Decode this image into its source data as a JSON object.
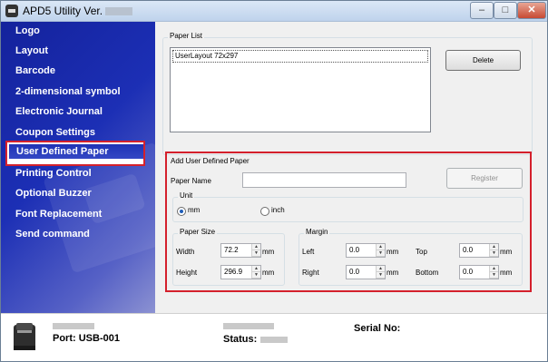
{
  "window": {
    "title": "APD5 Utility Ver.",
    "minimize": "–",
    "maximize": "□",
    "close": "✕"
  },
  "sidebar": {
    "items": [
      {
        "label": "Logo"
      },
      {
        "label": "Layout"
      },
      {
        "label": "Barcode"
      },
      {
        "label": "2-dimensional symbol"
      },
      {
        "label": "Electronic Journal"
      },
      {
        "label": "Coupon Settings"
      },
      {
        "label": "User Defined Paper"
      },
      {
        "label": "Printing Control"
      },
      {
        "label": "Optional Buzzer"
      },
      {
        "label": "Font Replacement"
      },
      {
        "label": "Send command"
      }
    ],
    "active_index": 6
  },
  "paper_list": {
    "group_label": "Paper List",
    "items": [
      "UserLayout  72x297"
    ],
    "delete_label": "Delete"
  },
  "add_paper": {
    "group_label": "Add User Defined Paper",
    "name_label": "Paper Name",
    "name_value": "",
    "register_label": "Register",
    "unit": {
      "group_label": "Unit",
      "mm_label": "mm",
      "inch_label": "inch",
      "selected": "mm"
    },
    "paper_size": {
      "group_label": "Paper Size",
      "width_label": "Width",
      "width_value": "72.2",
      "height_label": "Height",
      "height_value": "296.9",
      "unit": "mm"
    },
    "margin": {
      "group_label": "Margin",
      "left_label": "Left",
      "left_value": "0.0",
      "right_label": "Right",
      "right_value": "0.0",
      "top_label": "Top",
      "top_value": "0.0",
      "bottom_label": "Bottom",
      "bottom_value": "0.0",
      "unit": "mm"
    }
  },
  "status": {
    "port_label": "Port: USB-001",
    "status_label": "Status:",
    "serial_label": "Serial No:"
  },
  "colors": {
    "highlight": "#d4202c",
    "sidebar": "#1c2fb5"
  }
}
